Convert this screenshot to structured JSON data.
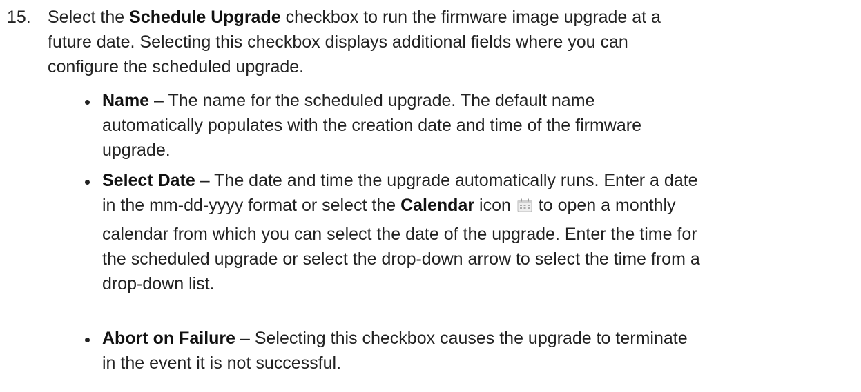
{
  "step": {
    "number": "15.",
    "lines": [
      [
        "Select the ",
        "Schedule Upgrade",
        " checkbox to run the firmware image upgrade at a"
      ],
      "future date. Selecting this checkbox displays additional fields where you can",
      "configure the scheduled upgrade."
    ]
  },
  "bullets": [
    {
      "term": "Name",
      "lines": [
        " – The name for the scheduled upgrade. The default name",
        "automatically populates with the creation date and time of the firmware",
        "upgrade."
      ]
    },
    {
      "term": "Select Date",
      "line1": " – The date and time the upgrade automatically runs. Enter a date",
      "line2_pre": "in the mm-dd-yyyy format or select the ",
      "line2_bold": "Calendar",
      "line2_mid": " icon ",
      "line2_post": " to open a monthly",
      "icon": "calendar-icon",
      "lines_rest": [
        "calendar from which you can select the date of the upgrade. Enter the time for",
        "the scheduled upgrade or select the drop-down arrow to select the time from a",
        "drop-down list."
      ]
    },
    {
      "term": "Abort on Failure",
      "lines": [
        " – Selecting this checkbox causes the upgrade to terminate",
        "in the event it is not successful."
      ]
    }
  ]
}
